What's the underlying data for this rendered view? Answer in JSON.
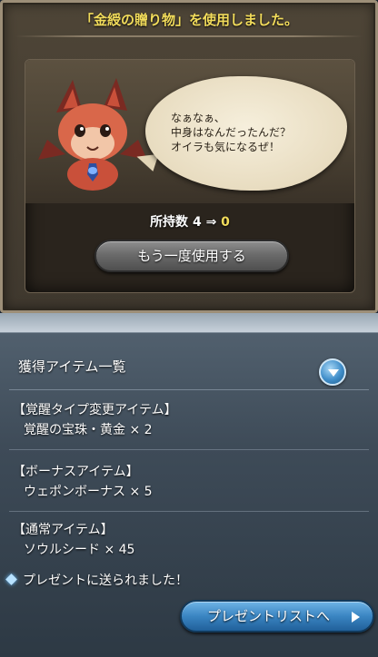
{
  "dialog": {
    "title": "「金綬の贈り物」を使用しました。",
    "speech_lines": [
      "なぁなぁ、",
      "中身はなんだったんだ？",
      "オイラも気になるぜ！"
    ],
    "possess": {
      "label": "所持数",
      "from": "4",
      "arrow": "⇒",
      "to": "0"
    },
    "reuse_button": "もう一度使用する"
  },
  "rewards": {
    "header": "獲得アイテム一覧",
    "sections": [
      {
        "title": "【覚醒タイプ変更アイテム】",
        "item": "覚醒の宝珠・黄金 × 2"
      },
      {
        "title": "【ボーナスアイテム】",
        "item": "ウェポンボーナス × 5"
      },
      {
        "title": "【通常アイテム】",
        "item": "ソウルシード × 45"
      }
    ],
    "sent_message": "プレゼントに送られました！",
    "present_button": "プレゼントリストへ"
  },
  "icons": {
    "collapse": "chevron-down-icon",
    "sent": "diamond-icon",
    "present_arrow": "play-arrow-icon"
  },
  "colors": {
    "title_yellow": "#f2dc5b",
    "button_blue": "#3a85c2"
  }
}
